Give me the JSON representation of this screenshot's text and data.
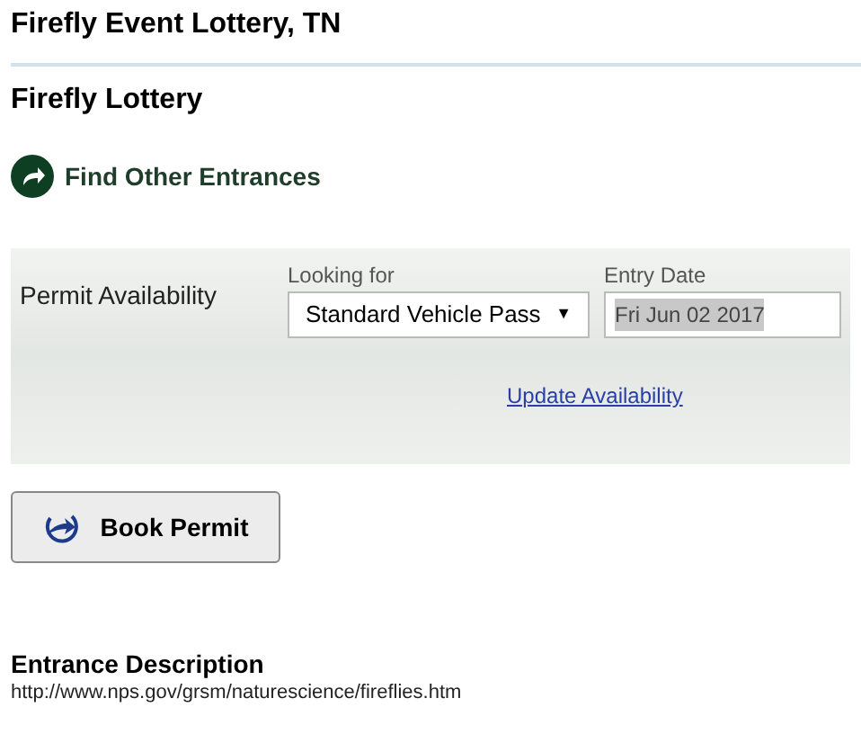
{
  "page_title": "Firefly Event Lottery, TN",
  "section_title": "Firefly Lottery",
  "find_link": "Find Other Entrances",
  "availability": {
    "label": "Permit Availability",
    "looking_for": {
      "label": "Looking for",
      "value": "Standard Vehicle Pass",
      "caret": "▼"
    },
    "entry_date": {
      "label": "Entry Date",
      "value": "Fri Jun 02 2017",
      "highlighted": true
    },
    "update_link": "Update Availability"
  },
  "book_button": "Book Permit",
  "description": {
    "heading": "Entrance Description",
    "url": "http://www.nps.gov/grsm/naturescience/fireflies.htm"
  }
}
